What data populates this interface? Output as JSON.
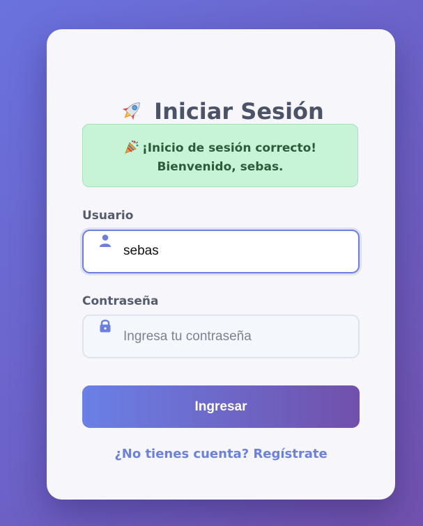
{
  "login": {
    "title": "Iniciar Sesión",
    "title_icon": "rocket-icon",
    "alert": {
      "icon": "party-popper-icon",
      "line1": "¡Inicio de sesión correcto!",
      "line2": "Bienvenido, sebas."
    },
    "username": {
      "label": "Usuario",
      "value": "sebas",
      "icon": "user-icon"
    },
    "password": {
      "label": "Contraseña",
      "placeholder": "Ingresa tu contraseña",
      "value": "",
      "icon": "lock-icon"
    },
    "submit_label": "Ingresar",
    "register_link": "¿No tienes cuenta? Regístrate"
  },
  "colors": {
    "background_start": "#6a72de",
    "background_end": "#7252ad",
    "card": "#f6f6fb",
    "title": "#4a5368",
    "alert_bg": "#c7f3d6",
    "alert_text": "#2c5a3b",
    "accent": "#6a7fe0",
    "button_start": "#6a80e6",
    "button_end": "#7150ab",
    "link": "#6b82dc"
  }
}
